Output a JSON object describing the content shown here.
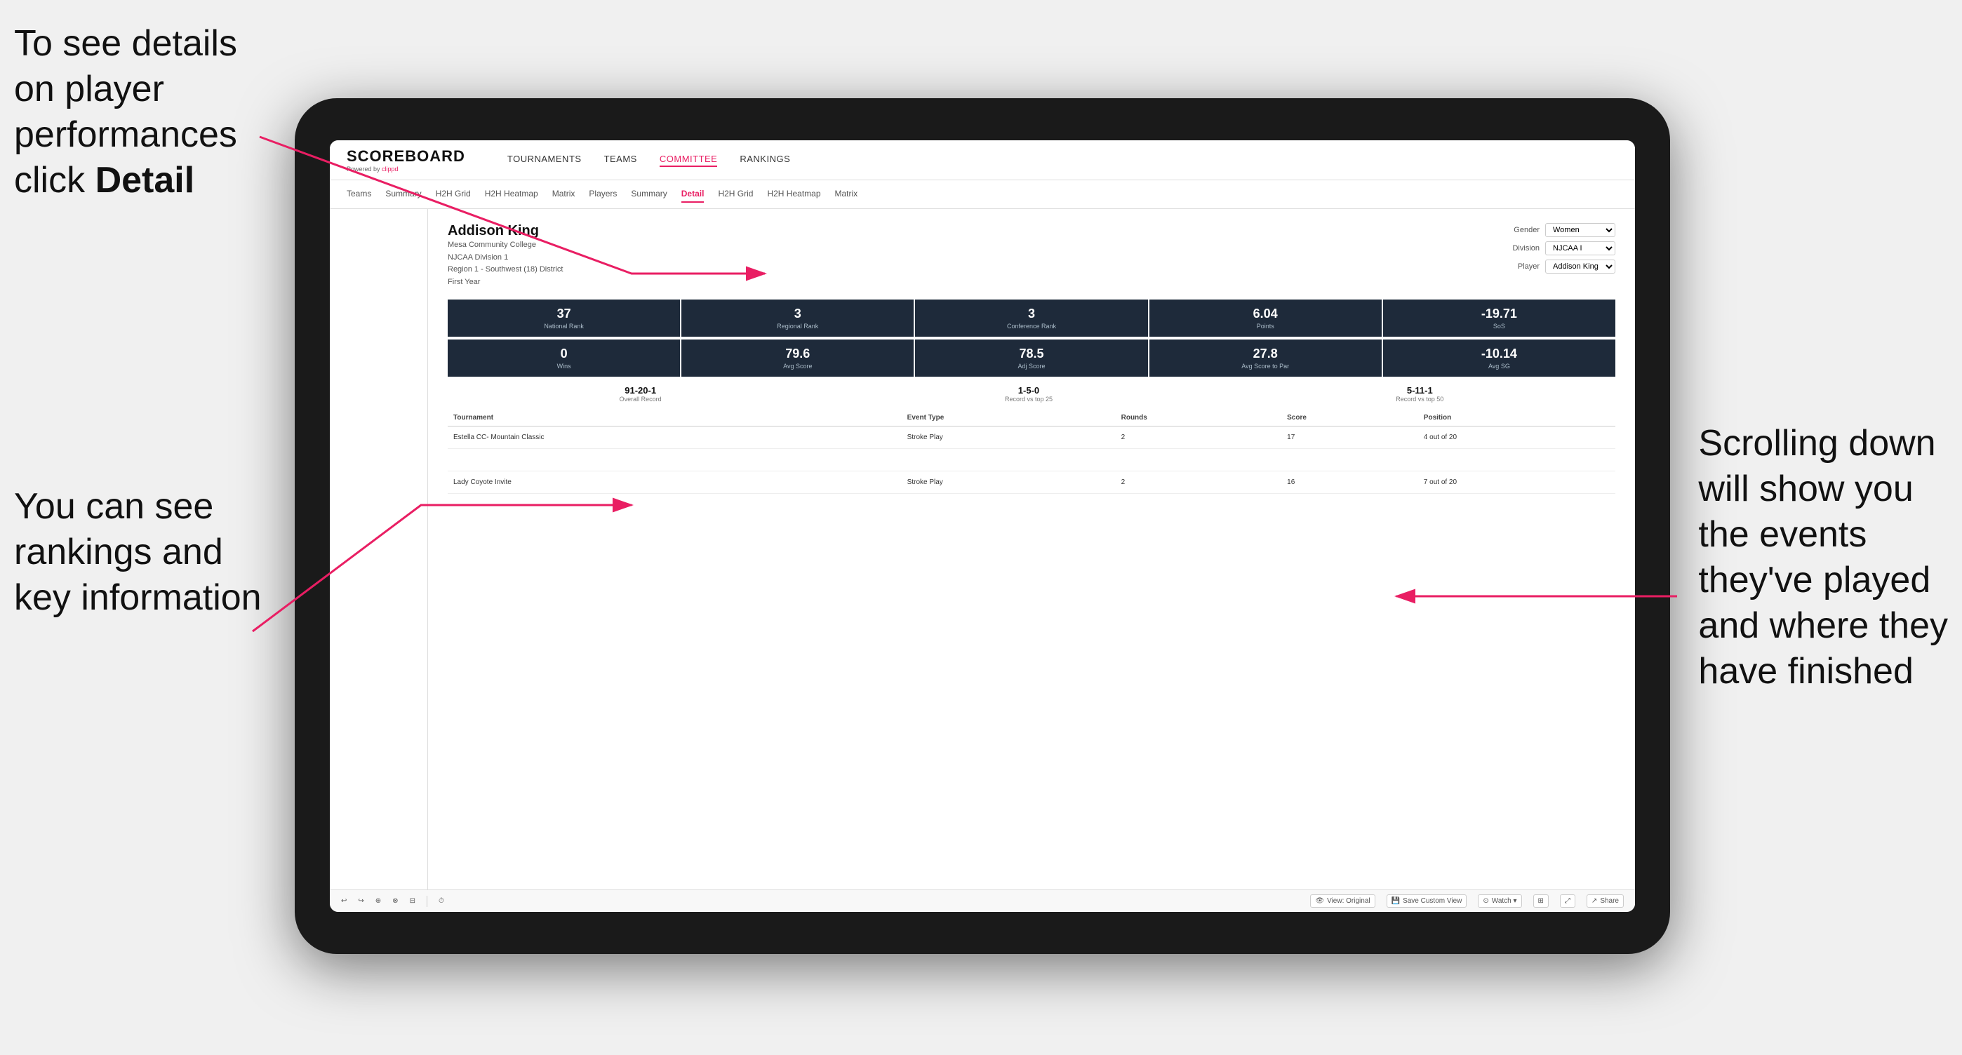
{
  "annotations": {
    "top_left": "To see details on player performances click ",
    "top_left_bold": "Detail",
    "bottom_left_line1": "You can see",
    "bottom_left_line2": "rankings and",
    "bottom_left_line3": "key information",
    "right_line1": "Scrolling down",
    "right_line2": "will show you",
    "right_line3": "the events",
    "right_line4": "they've played",
    "right_line5": "and where they",
    "right_line6": "have finished"
  },
  "app": {
    "logo": {
      "title": "SCOREBOARD",
      "subtitle": "Powered by clippd"
    },
    "nav": {
      "items": [
        "TOURNAMENTS",
        "TEAMS",
        "COMMITTEE",
        "RANKINGS"
      ]
    },
    "sub_nav": {
      "items": [
        "Teams",
        "Summary",
        "H2H Grid",
        "H2H Heatmap",
        "Matrix",
        "Players",
        "Summary",
        "Detail",
        "H2H Grid",
        "H2H Heatmap",
        "Matrix"
      ],
      "active": "Detail"
    }
  },
  "player": {
    "name": "Addison King",
    "college": "Mesa Community College",
    "division": "NJCAA Division 1",
    "region": "Region 1 - Southwest (18) District",
    "year": "First Year",
    "controls": {
      "gender_label": "Gender",
      "gender_value": "Women",
      "division_label": "Division",
      "division_value": "NJCAA I",
      "player_label": "Player",
      "player_value": "Addison King"
    }
  },
  "stats_row1": [
    {
      "value": "37",
      "label": "National Rank"
    },
    {
      "value": "3",
      "label": "Regional Rank"
    },
    {
      "value": "3",
      "label": "Conference Rank"
    },
    {
      "value": "6.04",
      "label": "Points"
    },
    {
      "value": "-19.71",
      "label": "SoS"
    }
  ],
  "stats_row2": [
    {
      "value": "0",
      "label": "Wins"
    },
    {
      "value": "79.6",
      "label": "Avg Score"
    },
    {
      "value": "78.5",
      "label": "Adj Score"
    },
    {
      "value": "27.8",
      "label": "Avg Score to Par"
    },
    {
      "value": "-10.14",
      "label": "Avg SG"
    }
  ],
  "records": [
    {
      "value": "91-20-1",
      "label": "Overall Record"
    },
    {
      "value": "1-5-0",
      "label": "Record vs top 25"
    },
    {
      "value": "5-11-1",
      "label": "Record vs top 50"
    }
  ],
  "table": {
    "headers": [
      "Tournament",
      "Event Type",
      "Rounds",
      "Score",
      "Position"
    ],
    "rows": [
      {
        "tournament": "Estella CC- Mountain Classic",
        "event_type": "Stroke Play",
        "rounds": "2",
        "score": "17",
        "position": "4 out of 20"
      },
      {
        "tournament": "",
        "event_type": "",
        "rounds": "",
        "score": "",
        "position": ""
      },
      {
        "tournament": "Lady Coyote Invite",
        "event_type": "Stroke Play",
        "rounds": "2",
        "score": "16",
        "position": "7 out of 20"
      }
    ]
  },
  "toolbar": {
    "buttons": [
      "View: Original",
      "Save Custom View",
      "Watch ▾",
      "Share"
    ]
  }
}
